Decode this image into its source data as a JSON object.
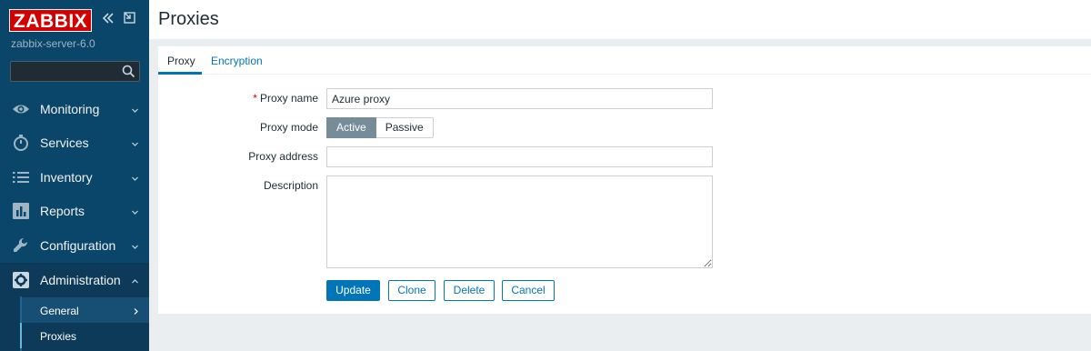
{
  "app": {
    "logo": "ZABBIX",
    "server_name": "zabbix-server-6.0"
  },
  "search": {
    "value": "",
    "placeholder": ""
  },
  "sidebar": {
    "items": [
      {
        "label": "Monitoring",
        "icon": "eye-icon"
      },
      {
        "label": "Services",
        "icon": "stopwatch-icon"
      },
      {
        "label": "Inventory",
        "icon": "list-icon"
      },
      {
        "label": "Reports",
        "icon": "bar-chart-icon"
      },
      {
        "label": "Configuration",
        "icon": "wrench-icon"
      },
      {
        "label": "Administration",
        "icon": "gear-icon"
      }
    ],
    "submenu": [
      {
        "label": "General"
      },
      {
        "label": "Proxies"
      }
    ]
  },
  "page": {
    "title": "Proxies"
  },
  "tabs": [
    {
      "label": "Proxy"
    },
    {
      "label": "Encryption"
    }
  ],
  "form": {
    "proxy_name_label": "Proxy name",
    "proxy_name_value": "Azure proxy",
    "proxy_mode_label": "Proxy mode",
    "mode_active": "Active",
    "mode_passive": "Passive",
    "selected_mode": "Active",
    "proxy_address_label": "Proxy address",
    "proxy_address_value": "",
    "description_label": "Description",
    "description_value": ""
  },
  "buttons": {
    "update": "Update",
    "clone": "Clone",
    "delete": "Delete",
    "cancel": "Cancel"
  },
  "colors": {
    "sidebar_bg": "#0a466a",
    "logo_red": "#d40000",
    "accent_blue": "#0275b8",
    "active_mode": "#768d99"
  }
}
